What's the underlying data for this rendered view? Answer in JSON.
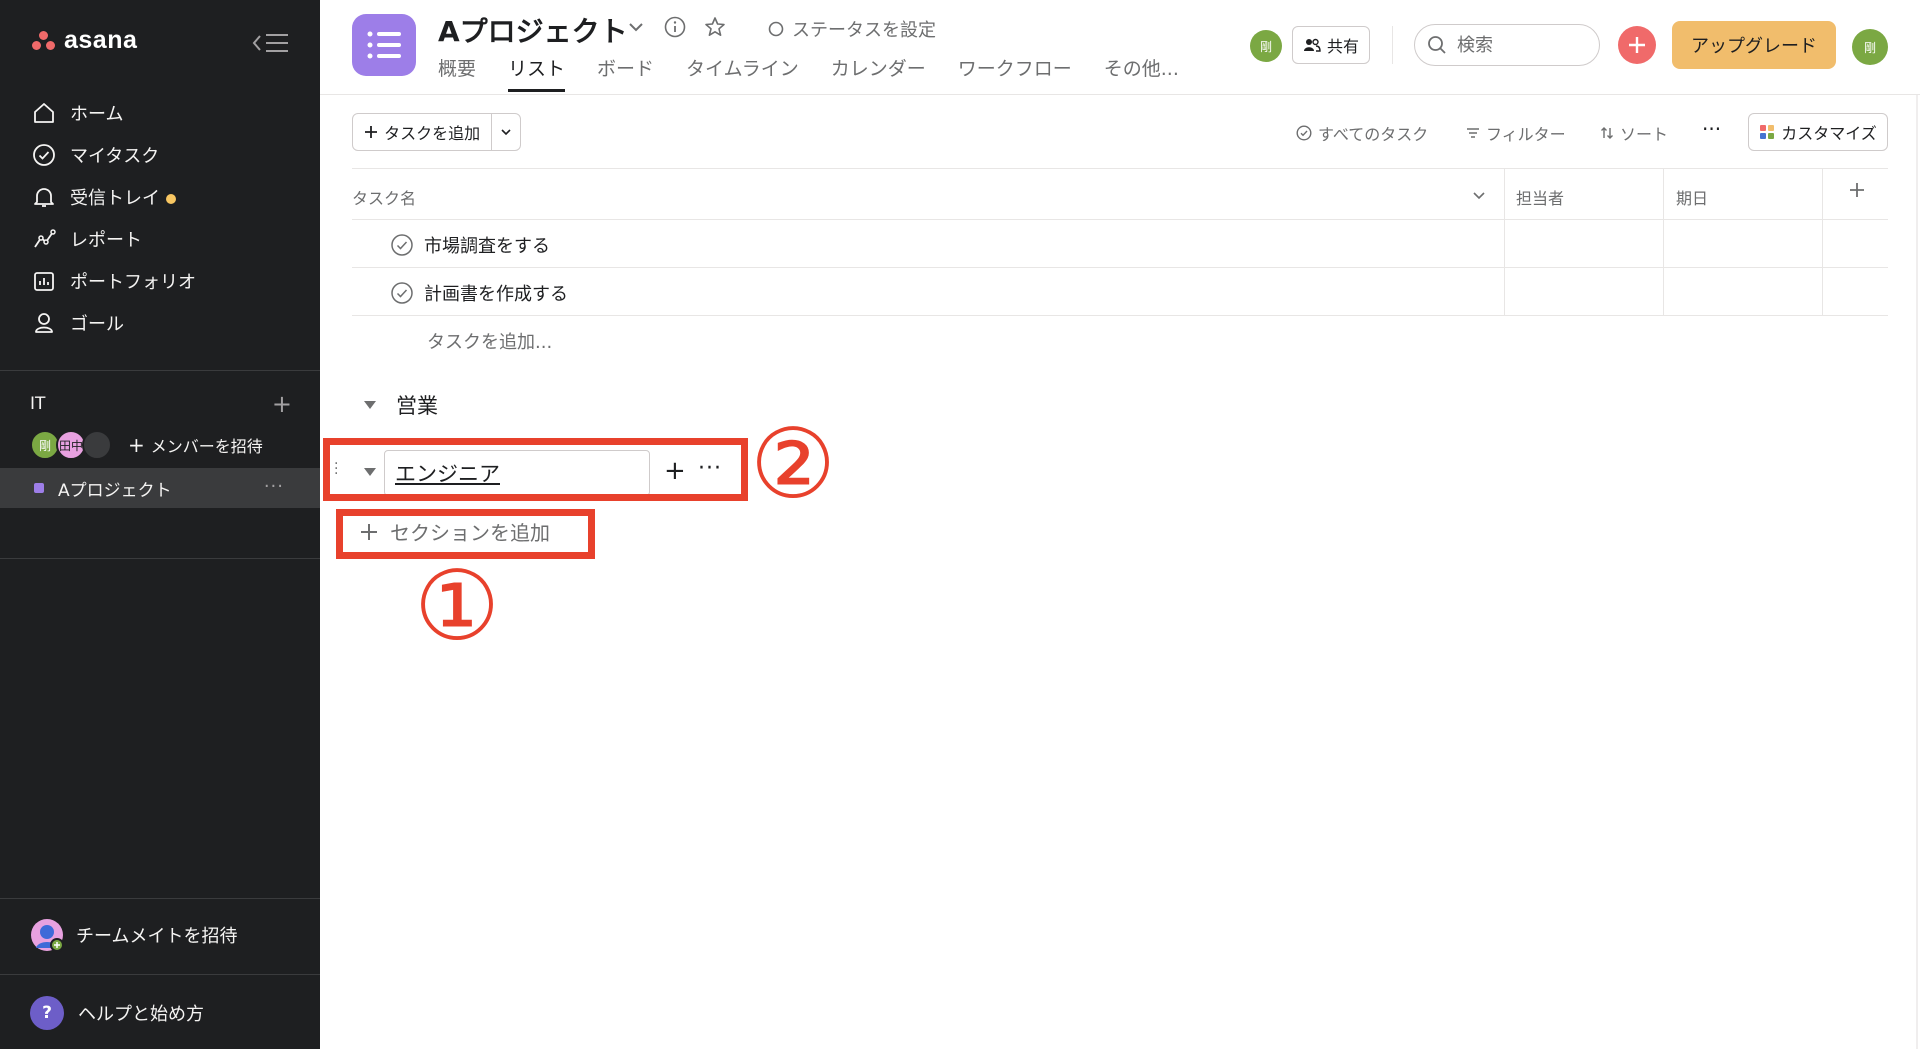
{
  "sidebar": {
    "logo_text": "asana",
    "nav": [
      {
        "label": "ホーム",
        "icon": "home-icon"
      },
      {
        "label": "マイタスク",
        "icon": "check-circle-icon"
      },
      {
        "label": "受信トレイ",
        "icon": "bell-icon"
      },
      {
        "label": "レポート",
        "icon": "chart-line-icon"
      },
      {
        "label": "ポートフォリオ",
        "icon": "portfolio-icon"
      },
      {
        "label": "ゴール",
        "icon": "person-goal-icon"
      }
    ],
    "team": {
      "name": "IT",
      "avatars": [
        {
          "text": "剛",
          "color": "#7ba843"
        },
        {
          "text": "田中",
          "color": "#e8a1e0"
        },
        {
          "text": "",
          "color": "#3a3b3d"
        }
      ],
      "invite_label": "メンバーを招待"
    },
    "project": {
      "name": "Aプロジェクト",
      "color": "#9d7ee8",
      "more": "···"
    },
    "invite_teammate": "チームメイトを招待",
    "help": {
      "icon_text": "?",
      "label": "ヘルプと始め方"
    }
  },
  "header": {
    "project_title": "Aプロジェクト",
    "status_label": "ステータスを設定",
    "tabs": [
      "概要",
      "リスト",
      "ボード",
      "タイムライン",
      "カレンダー",
      "ワークフロー",
      "その他..."
    ],
    "active_tab": "リスト",
    "member_avatar": "剛",
    "share_label": "共有",
    "search_placeholder": "検索",
    "upgrade_label": "アップグレード",
    "user_avatar": "剛"
  },
  "toolbar": {
    "add_task_label": "タスクを追加",
    "all_tasks_label": "すべてのタスク",
    "filter_label": "フィルター",
    "sort_label": "ソート",
    "more_label": "···",
    "customize_label": "カスタマイズ"
  },
  "table": {
    "columns": [
      "タスク名",
      "担当者",
      "期日"
    ],
    "tasks": [
      "市場調査をする",
      "計画書を作成する"
    ],
    "add_task_inline": "タスクを追加..."
  },
  "section": {
    "name": "営業",
    "editing_value": "エンジニア",
    "add_section_label": "セクションを追加"
  },
  "annotations": {
    "one": "①",
    "two": "②",
    "color": "#e8412c"
  },
  "colors": {
    "sidebar_bg": "#1e1f21",
    "brand_coral": "#f06a6a",
    "upgrade_bg": "#f1bd6c",
    "project_purple": "#9d7ee8"
  }
}
